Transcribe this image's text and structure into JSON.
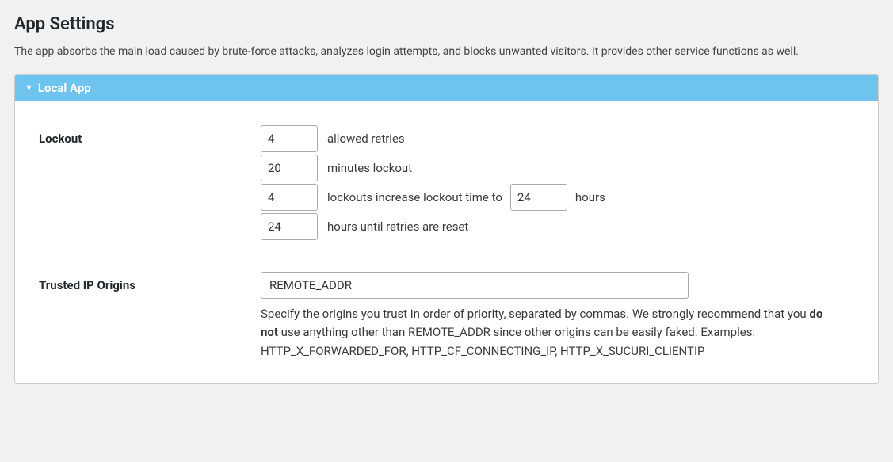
{
  "header": {
    "title": "App Settings",
    "description": "The app absorbs the main load caused by brute-force attacks, analyzes login attempts, and blocks unwanted visitors. It provides other service functions as well."
  },
  "panel": {
    "title": "Local App",
    "sections": {
      "lockout": {
        "label": "Lockout",
        "allowed_retries_value": "4",
        "allowed_retries_text": "allowed retries",
        "minutes_lockout_value": "20",
        "minutes_lockout_text": "minutes lockout",
        "increase_count_value": "4",
        "increase_text_pre": "lockouts increase lockout time to",
        "increase_hours_value": "24",
        "increase_text_post": "hours",
        "reset_hours_value": "24",
        "reset_text": "hours until retries are reset"
      },
      "trusted_ip": {
        "label": "Trusted IP Origins",
        "value": "REMOTE_ADDR",
        "help_pre": "Specify the origins you trust in order of priority, separated by commas. We strongly recommend that you ",
        "help_bold": "do not",
        "help_post": " use anything other than REMOTE_ADDR since other origins can be easily faked. Examples: HTTP_X_FORWARDED_FOR, HTTP_CF_CONNECTING_IP, HTTP_X_SUCURI_CLIENTIP"
      }
    }
  }
}
